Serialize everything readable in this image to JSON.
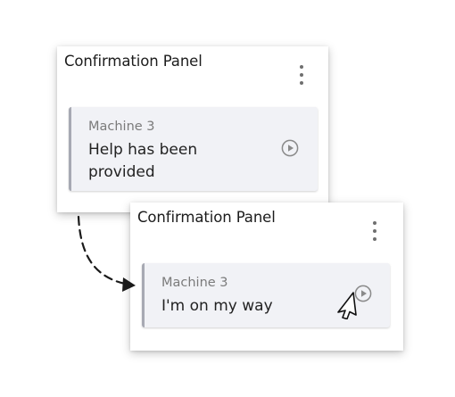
{
  "panels": [
    {
      "title": "Confirmation Panel",
      "card": {
        "subtitle": "Machine 3",
        "message": "Help has been provided"
      },
      "icons": {
        "menu": "more-vertical-icon",
        "play": "play-circle-icon"
      }
    },
    {
      "title": "Confirmation Panel",
      "card": {
        "subtitle": "Machine 3",
        "message": "I'm on my way"
      },
      "icons": {
        "menu": "more-vertical-icon",
        "play": "play-circle-icon"
      }
    }
  ],
  "decorations": {
    "arrow_icon": "dashed-curved-arrow-icon",
    "cursor_icon": "mouse-pointer-icon"
  },
  "colors": {
    "card_background": "#f1f2f6",
    "card_accent": "#a7a9b3",
    "icon_gray": "#8a8a8a",
    "text_primary": "#222222",
    "text_secondary": "#7b7b7b"
  }
}
